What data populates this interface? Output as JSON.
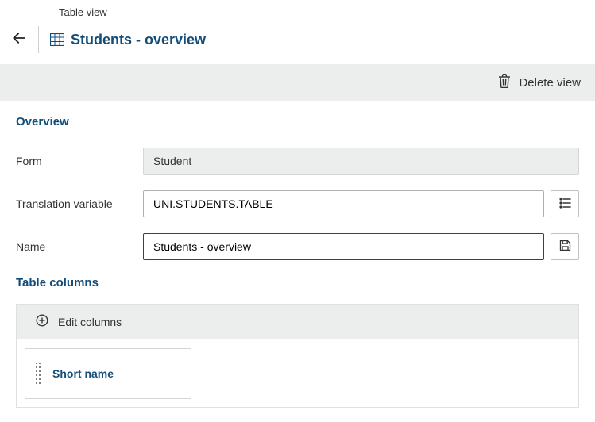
{
  "breadcrumb": {
    "label": "Table view"
  },
  "title": "Students - overview",
  "actions": {
    "delete_label": "Delete view"
  },
  "overview": {
    "section_title": "Overview",
    "form_label": "Form",
    "form_value": "Student",
    "translation_label": "Translation variable",
    "translation_value": "UNI.STUDENTS.TABLE",
    "name_label": "Name",
    "name_value": "Students - overview"
  },
  "table_columns": {
    "section_title": "Table columns",
    "edit_label": "Edit columns",
    "columns": [
      {
        "label": "Short name"
      }
    ]
  }
}
